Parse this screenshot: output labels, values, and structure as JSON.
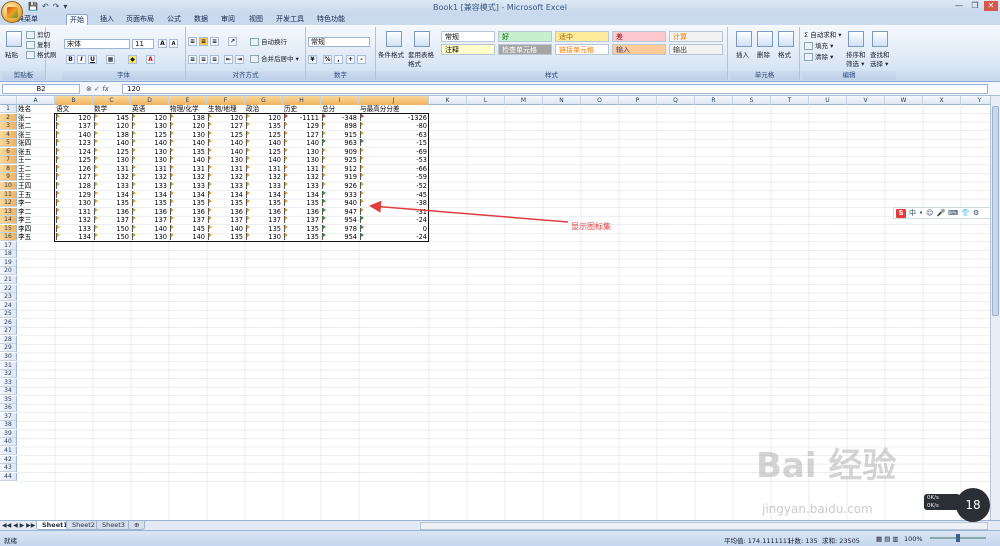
{
  "window": {
    "title": "Book1 [兼容模式] - Microsoft Excel",
    "qat": [
      "💾",
      "↶",
      "↷",
      "▾"
    ],
    "controls": [
      "—",
      "❐",
      "✕"
    ]
  },
  "tabs": [
    "经典菜单",
    "开始",
    "插入",
    "页面布局",
    "公式",
    "数据",
    "审阅",
    "视图",
    "开发工具",
    "特色功能"
  ],
  "active_tab": 1,
  "ribbon": {
    "clipboard": {
      "label": "剪贴板",
      "paste": "粘贴",
      "cut": "剪切",
      "copy": "复制",
      "painter": "格式刷"
    },
    "font": {
      "label": "字体",
      "name": "宋体",
      "size": "11",
      "bold": "B",
      "italic": "I",
      "underline": "U",
      "grow": "A",
      "shrink": "A"
    },
    "alignment": {
      "label": "对齐方式",
      "wrap": "自动换行",
      "merge": "合并后居中 ▾"
    },
    "number": {
      "label": "数字",
      "format": "常规",
      "percent": "%",
      "comma": ","
    },
    "styles": {
      "label": "样式",
      "conditional": "条件格式",
      "table": "套用表格格式",
      "cells": [
        {
          "text": "常规",
          "bg": "#ffffff",
          "color": "#000000"
        },
        {
          "text": "好",
          "bg": "#c6efce",
          "color": "#006100"
        },
        {
          "text": "适中",
          "bg": "#ffeb9c",
          "color": "#9c6500"
        },
        {
          "text": "差",
          "bg": "#ffc7ce",
          "color": "#9c0006"
        },
        {
          "text": "计算",
          "bg": "#f2f2f2",
          "color": "#fa7d00"
        },
        {
          "text": "注释",
          "bg": "#ffffcc",
          "color": "#000000"
        },
        {
          "text": "检查单元格",
          "bg": "#a5a5a5",
          "color": "#ffffff"
        },
        {
          "text": "链接单元格",
          "bg": "#ffffff",
          "color": "#fa7d00"
        },
        {
          "text": "输入",
          "bg": "#ffcc99",
          "color": "#3f3f76"
        },
        {
          "text": "输出",
          "bg": "#f2f2f2",
          "color": "#3f3f3f"
        }
      ]
    },
    "cells_group": {
      "label": "单元格",
      "insert": "插入",
      "delete": "删除",
      "format": "格式"
    },
    "editing": {
      "label": "编辑",
      "autosum": "自动求和 ▾",
      "fill": "填充 ▾",
      "clear": "清除 ▾",
      "sort": "排序和筛选 ▾",
      "find": "查找和选择 ▾"
    }
  },
  "formula_bar": {
    "name_box": "B2",
    "fx": "fx",
    "value": "120"
  },
  "columns": [
    "A",
    "B",
    "C",
    "D",
    "E",
    "F",
    "G",
    "H",
    "I",
    "J",
    "K",
    "L",
    "M",
    "N",
    "O",
    "P",
    "Q",
    "R",
    "S",
    "T",
    "U",
    "V",
    "W",
    "X",
    "Y"
  ],
  "headers": [
    "姓名",
    "语文",
    "数学",
    "英语",
    "物理/化学",
    "生物/地理",
    "政治",
    "历史",
    "总分",
    "与最高分分差"
  ],
  "rows": [
    [
      "张一",
      "120",
      "145",
      "120",
      "138",
      "120",
      "120",
      "-1111",
      "-348",
      "-1326"
    ],
    [
      "张二",
      "137",
      "120",
      "130",
      "120",
      "127",
      "135",
      "129",
      "898",
      "-80"
    ],
    [
      "张三",
      "140",
      "138",
      "125",
      "130",
      "125",
      "125",
      "127",
      "915",
      "-63"
    ],
    [
      "张四",
      "123",
      "140",
      "140",
      "140",
      "140",
      "140",
      "140",
      "963",
      "-15"
    ],
    [
      "张五",
      "124",
      "125",
      "130",
      "135",
      "140",
      "125",
      "130",
      "909",
      "-69"
    ],
    [
      "王一",
      "125",
      "130",
      "130",
      "140",
      "130",
      "140",
      "130",
      "925",
      "-53"
    ],
    [
      "王二",
      "126",
      "131",
      "131",
      "131",
      "131",
      "131",
      "131",
      "912",
      "-66"
    ],
    [
      "王三",
      "127",
      "132",
      "132",
      "132",
      "132",
      "132",
      "132",
      "919",
      "-59"
    ],
    [
      "王四",
      "128",
      "133",
      "133",
      "133",
      "133",
      "133",
      "133",
      "926",
      "-52"
    ],
    [
      "王五",
      "129",
      "134",
      "134",
      "134",
      "134",
      "134",
      "134",
      "933",
      "-45"
    ],
    [
      "李一",
      "130",
      "135",
      "135",
      "135",
      "135",
      "135",
      "135",
      "940",
      "-38"
    ],
    [
      "李二",
      "131",
      "136",
      "136",
      "136",
      "136",
      "136",
      "136",
      "947",
      "-31"
    ],
    [
      "李三",
      "132",
      "137",
      "137",
      "137",
      "137",
      "137",
      "137",
      "954",
      "-24"
    ],
    [
      "李四",
      "133",
      "150",
      "140",
      "145",
      "140",
      "135",
      "135",
      "978",
      "0"
    ],
    [
      "李五",
      "134",
      "150",
      "130",
      "140",
      "135",
      "130",
      "135",
      "954",
      "-24"
    ]
  ],
  "row_count": 44,
  "annotation": "显示图标集",
  "sheets": [
    "Sheet1",
    "Sheet2",
    "Sheet3"
  ],
  "active_sheet": 0,
  "status": {
    "ready": "就绪",
    "average": "平均值: 174.1111111",
    "count": "计数: 135",
    "sum": "求和: 23505",
    "zoom": "100%"
  },
  "ime": {
    "logo": "S",
    "items": [
      "中",
      "•",
      "☺",
      "🎤",
      "⌨",
      "👕",
      "⚙"
    ]
  },
  "watermark": {
    "main": "Bai 经验",
    "sub": "jingyan.baidu.com"
  },
  "overlay": {
    "bubble": "18",
    "net_up": "0K/s",
    "net_down": "0K/s"
  },
  "colors": {
    "accent": "#e23c3c",
    "selection": "#f1b25f",
    "ribbon": "#dbe7f5"
  }
}
